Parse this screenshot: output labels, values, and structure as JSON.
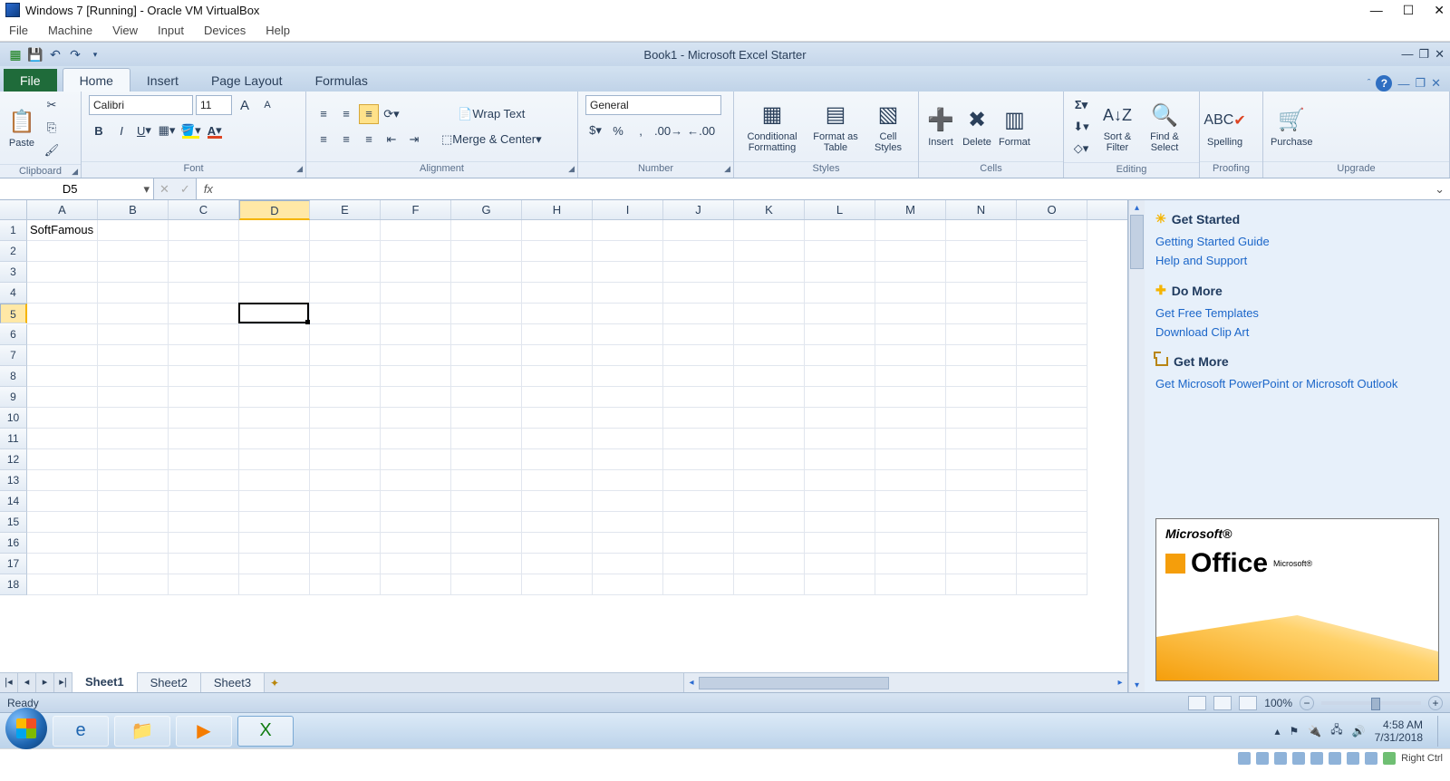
{
  "vb": {
    "title": "Windows 7 [Running] - Oracle VM VirtualBox",
    "menu": [
      "File",
      "Machine",
      "View",
      "Input",
      "Devices",
      "Help"
    ],
    "host_key": "Right Ctrl"
  },
  "excel": {
    "title": "Book1  -  Microsoft Excel Starter",
    "tabs": {
      "file": "File",
      "items": [
        "Home",
        "Insert",
        "Page Layout",
        "Formulas"
      ],
      "active": "Home"
    },
    "ribbon": {
      "clipboard": "Clipboard",
      "paste": "Paste",
      "font_group": "Font",
      "font": "Calibri",
      "size": "11",
      "alignment": "Alignment",
      "wrap": "Wrap Text",
      "merge": "Merge & Center",
      "number_group": "Number",
      "numfmt": "General",
      "styles_group": "Styles",
      "cond": "Conditional Formatting",
      "fmt_tbl": "Format as Table",
      "cell_sty": "Cell Styles",
      "cells_group": "Cells",
      "insert": "Insert",
      "delete": "Delete",
      "format": "Format",
      "editing_group": "Editing",
      "sort": "Sort & Filter",
      "find": "Find & Select",
      "proofing_group": "Proofing",
      "spelling": "Spelling",
      "upgrade_group": "Upgrade",
      "purchase": "Purchase"
    },
    "namebox": "D5",
    "columns": [
      "A",
      "B",
      "C",
      "D",
      "E",
      "F",
      "G",
      "H",
      "I",
      "J",
      "K",
      "L",
      "M",
      "N",
      "O"
    ],
    "row_count": 18,
    "active": {
      "row": 5,
      "col": "D",
      "col_index": 3
    },
    "cells": {
      "A1": "SoftFamous"
    },
    "sheet_tabs": [
      "Sheet1",
      "Sheet2",
      "Sheet3"
    ],
    "active_sheet": "Sheet1",
    "status": "Ready",
    "zoom": "100%"
  },
  "task": {
    "h1": "Get Started",
    "l1": "Getting Started Guide",
    "l2": "Help and Support",
    "h2": "Do More",
    "l3": "Get Free Templates",
    "l4": "Download Clip Art",
    "h3": "Get More",
    "l5": "Get Microsoft PowerPoint or Microsoft Outlook",
    "ms": "Microsoft®",
    "office": "Office"
  },
  "win": {
    "time": "4:58 AM",
    "date": "7/31/2018"
  }
}
